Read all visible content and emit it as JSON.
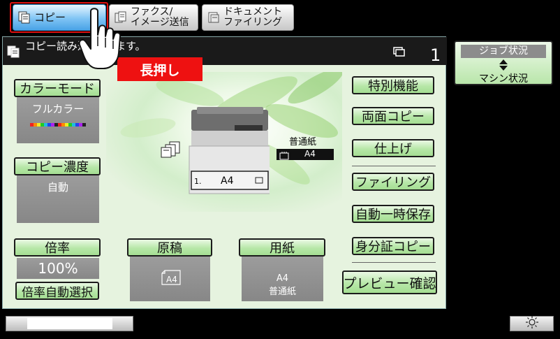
{
  "tabs": [
    {
      "label": "コピー",
      "active": true
    },
    {
      "label_line1": "ファクス/",
      "label_line2": "イメージ送信"
    },
    {
      "label_line1": "ドキュメント",
      "label_line2": "ファイリング"
    }
  ],
  "message": "コピー読み込みできます。",
  "message_visible": "コピー読み込",
  "message_tail": "きます。",
  "copy_count": "1",
  "left": {
    "color_mode_button": "カラーモード",
    "color_mode_value": "フルカラー",
    "density_button": "コピー濃度",
    "density_value": "自動",
    "ratio_button": "倍率",
    "ratio_value": "100%",
    "auto_ratio_button": "倍率自動選択"
  },
  "center": {
    "original_button": "原稿",
    "original_size": "A4",
    "paper_button": "用紙",
    "paper_size": "A4",
    "paper_type": "普通紙",
    "tray_paper_type": "普通紙",
    "tray_paper_size": "A4",
    "machine_tray_size": "A4",
    "machine_tray_number": "1."
  },
  "right_buttons": {
    "special": "特別機能",
    "duplex": "両面コピー",
    "finish": "仕上げ",
    "filing": "ファイリング",
    "quick_file": "自動一時保存",
    "id_copy": "身分証コピー",
    "preview": "プレビュー確認"
  },
  "job_status": {
    "top": "ジョブ状況",
    "bottom": "マシン状況"
  },
  "callout": "長押し",
  "icons": [
    "copy-icon",
    "fax-icon",
    "filing-icon",
    "hand-pointer-icon",
    "brightness-icon",
    "tray-icon",
    "original-feed-icon"
  ],
  "colors": {
    "accent_green": "#b7e7a8",
    "tab_active": "#49a3e6",
    "callout_red": "#e11111"
  }
}
